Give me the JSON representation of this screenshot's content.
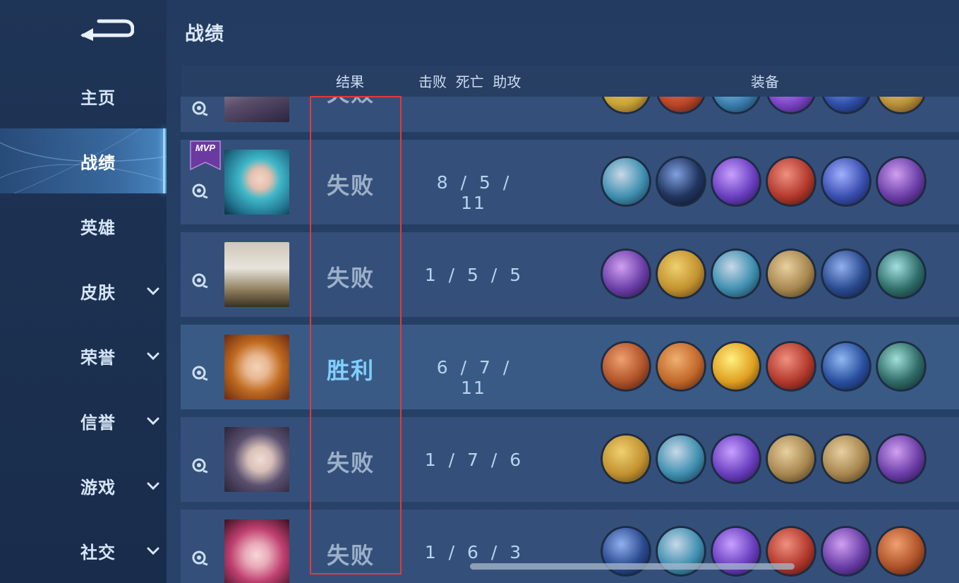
{
  "sidebar": {
    "items": [
      {
        "label": "主页",
        "has_chevron": false,
        "active": false
      },
      {
        "label": "战绩",
        "has_chevron": false,
        "active": true
      },
      {
        "label": "英雄",
        "has_chevron": false,
        "active": false
      },
      {
        "label": "皮肤",
        "has_chevron": true,
        "active": false
      },
      {
        "label": "荣誉",
        "has_chevron": true,
        "active": false
      },
      {
        "label": "信誉",
        "has_chevron": true,
        "active": false
      },
      {
        "label": "游戏",
        "has_chevron": true,
        "active": false
      },
      {
        "label": "社交",
        "has_chevron": true,
        "active": false
      }
    ]
  },
  "page": {
    "title": "战绩"
  },
  "columns": {
    "result": "结果",
    "kda": "击败  死亡  助攻",
    "equipment": "装备"
  },
  "rows": [
    {
      "result": "失败",
      "kda": "",
      "mvp": false,
      "win": false,
      "items": [
        "#c9a33a",
        "#b8462a",
        "#3b7fb0",
        "#7b46c4",
        "#2f4fa8",
        "#b8903a"
      ]
    },
    {
      "result": "失败",
      "kda": "8 / 5 / 11",
      "mvp": true,
      "mvp_label": "MVP",
      "win": false,
      "items": [
        "#3f8fb0",
        "#20355f",
        "#6a3fc0",
        "#b2392c",
        "#3a4fb0",
        "#6b3ea8"
      ]
    },
    {
      "result": "失败",
      "kda": "1 / 5 / 5",
      "mvp": false,
      "win": false,
      "items": [
        "#6b3ea8",
        "#c2922f",
        "#3f8fb0",
        "#a8874f",
        "#2a4a8f",
        "#2f6e6a"
      ]
    },
    {
      "result": "胜利",
      "kda": "6 / 7 / 11",
      "mvp": false,
      "win": true,
      "items": [
        "#b0532a",
        "#c2682a",
        "#e0a020",
        "#b2392c",
        "#2a4fa0",
        "#2f6a66"
      ]
    },
    {
      "result": "失败",
      "kda": "1 / 7 / 6",
      "mvp": false,
      "win": false,
      "items": [
        "#c2922f",
        "#3f8fb0",
        "#6a3fc0",
        "#a8874f",
        "#a8874f",
        "#6b3ea8"
      ]
    },
    {
      "result": "失败",
      "kda": "1 / 6 / 3",
      "mvp": false,
      "win": false,
      "items": [
        "#2a4a8f",
        "#3f8fb0",
        "#6a3fc0",
        "#b2392c",
        "#6b3ea8",
        "#b0532a"
      ]
    }
  ]
}
